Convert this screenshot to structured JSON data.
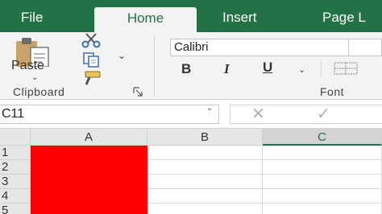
{
  "tabs": [
    "File",
    "Home",
    "Insert",
    "Page L"
  ],
  "clipboard": {
    "paste_label": "Paste",
    "group_label": "Clipboard",
    "icons": [
      "paste-icon",
      "cut-icon",
      "copy-icon",
      "format-painter-icon",
      "dialog-launcher-icon"
    ]
  },
  "font": {
    "name": "Calibri",
    "bold": "B",
    "italic": "I",
    "underline": "U",
    "group_label": "Font"
  },
  "formula_bar": {
    "name_box": "C11",
    "cancel_symbol": "✕",
    "enter_symbol": "✓"
  },
  "grid": {
    "columns": [
      "A",
      "B",
      "C"
    ],
    "selected_column": "C",
    "rows": [
      "1",
      "2",
      "3",
      "4",
      "5"
    ],
    "filled_column": "A",
    "fill_color": "#ff0000"
  },
  "colors": {
    "accent": "#217346",
    "ribbon_bg": "#f3f3f3"
  }
}
